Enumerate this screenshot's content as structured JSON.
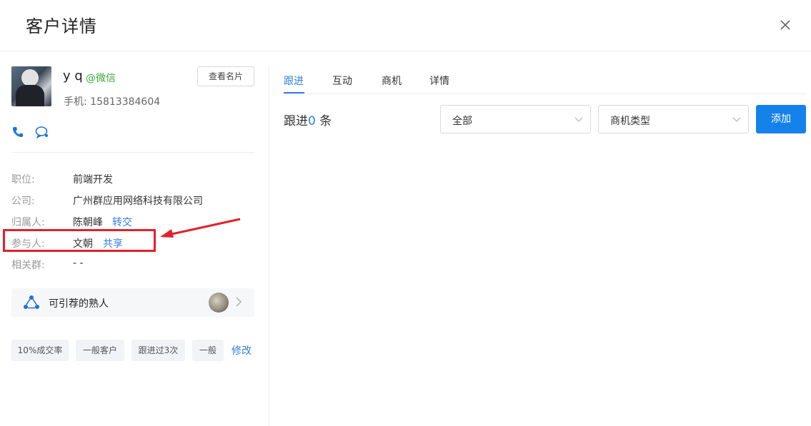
{
  "header": {
    "title": "客户详情"
  },
  "profile": {
    "name": "y q",
    "source": "@微信",
    "phone_label": "手机:",
    "phone": "15813384604",
    "card_button": "查看名片"
  },
  "info": [
    {
      "label": "职位:",
      "value": "前端开发",
      "action": ""
    },
    {
      "label": "公司:",
      "value": "广州群应用网络科技有限公司",
      "action": ""
    },
    {
      "label": "归属人:",
      "value": "陈朝峰",
      "action": "转交"
    },
    {
      "label": "参与人:",
      "value": "文朝",
      "action": "共享"
    },
    {
      "label": "相关群:",
      "value": "- -",
      "action": ""
    }
  ],
  "referral": {
    "label": "可引荐的熟人"
  },
  "tags": [
    "10%成交率",
    "一般客户",
    "跟进过3次",
    "一般"
  ],
  "tags_edit": "修改",
  "tabs": [
    {
      "label": "跟进",
      "active": true
    },
    {
      "label": "互动",
      "active": false
    },
    {
      "label": "商机",
      "active": false
    },
    {
      "label": "详情",
      "active": false
    }
  ],
  "followup": {
    "prefix": "跟进",
    "count": "0",
    "suffix": " 条"
  },
  "filters": {
    "scope": "全部",
    "type": "商机类型"
  },
  "add_button": "添加",
  "colors": {
    "accent": "#1482ea",
    "link": "#2f7fe6",
    "wechat": "#3aa83a",
    "highlight": "#e2212a"
  }
}
